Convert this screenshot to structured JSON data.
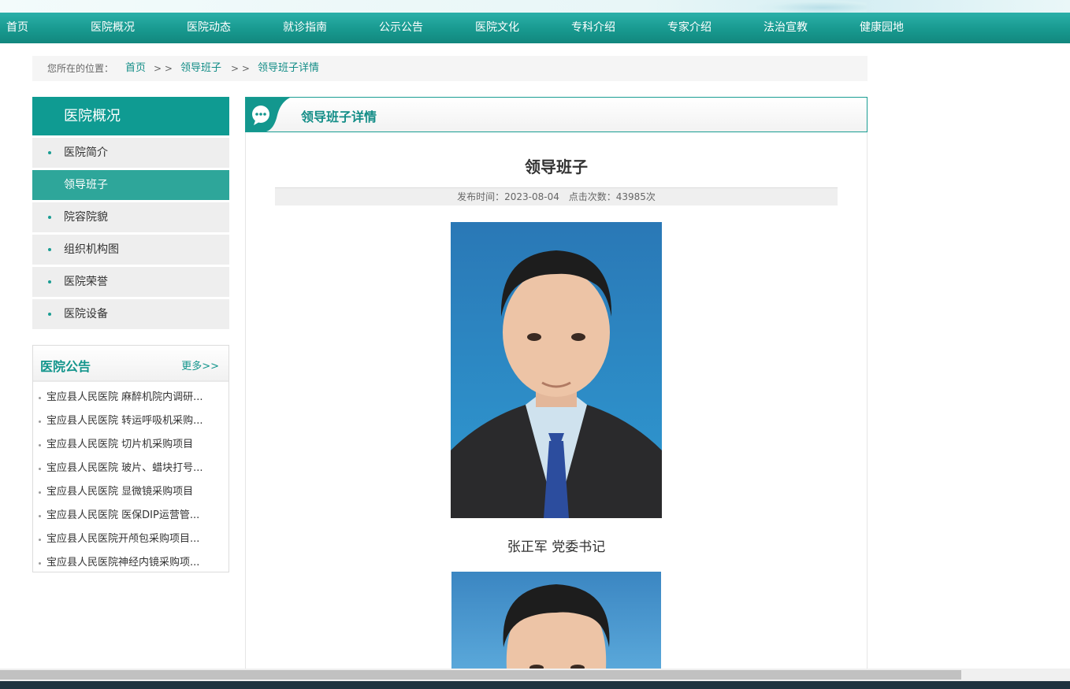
{
  "nav": [
    "首页",
    "医院概况",
    "医院动态",
    "就诊指南",
    "公示公告",
    "医院文化",
    "专科介绍",
    "专家介绍",
    "法治宣教",
    "健康园地"
  ],
  "breadcrumb": {
    "label": "您所在的位置：",
    "items": [
      "首页",
      "领导班子",
      "领导班子详情"
    ],
    "separator": "> >"
  },
  "sidebar": {
    "title": "医院概况",
    "items": [
      "医院简介",
      "领导班子",
      "院容院貌",
      "组织机构图",
      "医院荣誉",
      "医院设备"
    ],
    "active": "领导班子"
  },
  "notices": {
    "title": "医院公告",
    "more": "更多>>",
    "items": [
      "宝应县人民医院 麻醉机院内调研...",
      "宝应县人民医院 转运呼吸机采购...",
      "宝应县人民医院 切片机采购项目",
      "宝应县人民医院 玻片、蜡块打号...",
      "宝应县人民医院 显微镜采购项目",
      "宝应县人民医院 医保DIP运营管...",
      "宝应县人民医院开颅包采购项目...",
      "宝应县人民医院神经内镜采购项..."
    ]
  },
  "main": {
    "header": "领导班子详情",
    "article_title": "领导班子",
    "publish_time": "发布时间：2023-08-04",
    "views": "点击次数：43985次",
    "leaders": [
      {
        "caption": "张正军 党委书记"
      }
    ]
  },
  "colors": {
    "brand": "#12978e",
    "active": "#2ea69a",
    "link": "#138d87"
  }
}
